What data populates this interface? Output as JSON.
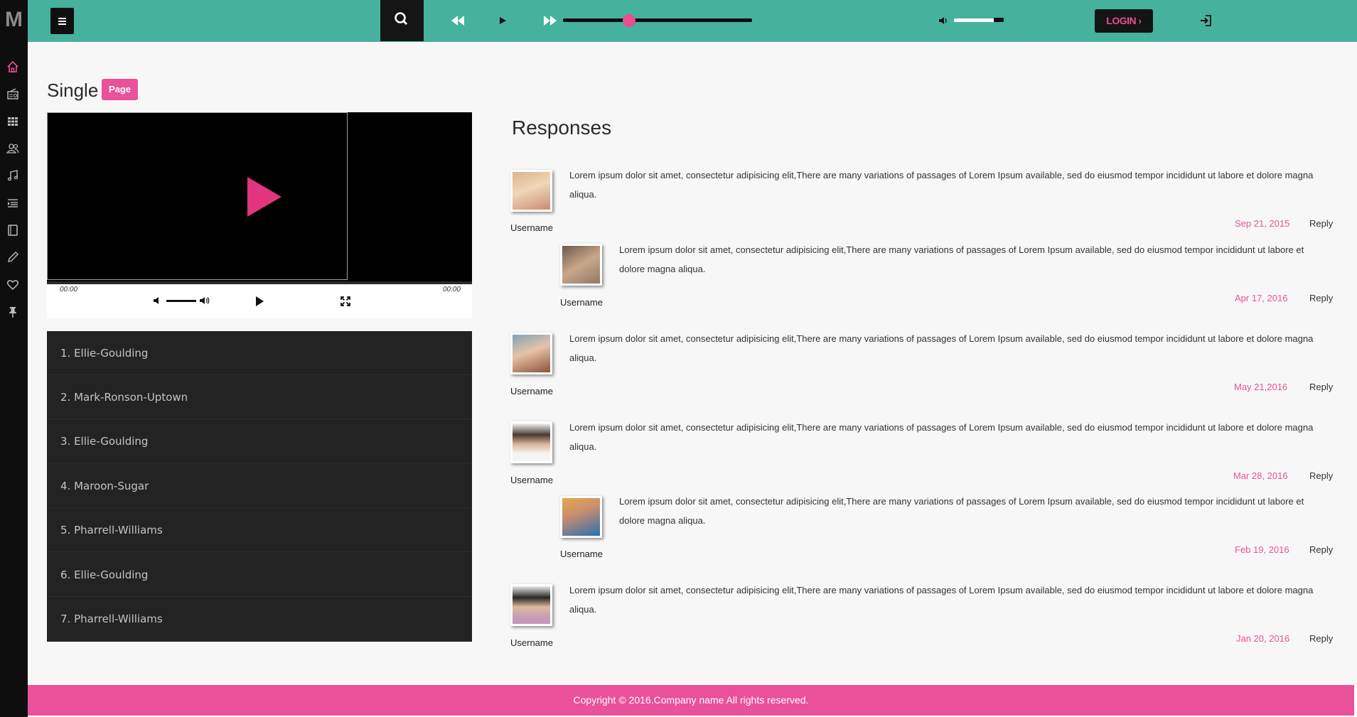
{
  "brand": {
    "logo": "M"
  },
  "sidebar": {
    "icons": [
      "home-icon",
      "radio-icon",
      "grid-icon",
      "users-icon",
      "music-icon",
      "playlist-icon",
      "book-icon",
      "pencil-icon",
      "heart-icon",
      "pin-icon"
    ],
    "active_color": "#e9519a"
  },
  "topbar": {
    "login_label": "LOGIN",
    "color": "#46b29d"
  },
  "player": {
    "seek_fraction": 0.35,
    "volume_fraction": 0.7
  },
  "page": {
    "title": "Single",
    "badge": "Page"
  },
  "video": {
    "time_start": "00:00",
    "time_end": "00:00"
  },
  "playlist": {
    "items": [
      "1. Ellie-Goulding",
      "2. Mark-Ronson-Uptown",
      "3. Ellie-Goulding",
      "4. Maroon-Sugar",
      "5. Pharrell-Williams",
      "6. Ellie-Goulding",
      "7. Pharrell-Williams"
    ]
  },
  "responses": {
    "title": "Responses",
    "reply_label": "Reply",
    "comments": [
      {
        "username": "Username",
        "date": "Sep 21, 2015",
        "line1": "Lorem ipsum dolor sit amet, consectetur adipisicing elit,There are many variations of passages of Lorem Ipsum available, sed do eiusmod tempor incididunt ut labore et dolore magna",
        "line2": "aliqua."
      },
      {
        "username": "Username",
        "date": "Apr 17, 2016",
        "line1": "Lorem ipsum dolor sit amet, consectetur adipisicing elit,There are many variations of passages of Lorem Ipsum available, sed do eiusmod tempor incididunt ut labore et",
        "line2": "dolore magna aliqua."
      },
      {
        "username": "Username",
        "date": "May 21,2016",
        "line1": "Lorem ipsum dolor sit amet, consectetur adipisicing elit,There are many variations of passages of Lorem Ipsum available, sed do eiusmod tempor incididunt ut labore et dolore magna",
        "line2": "aliqua."
      },
      {
        "username": "Username",
        "date": "Mar 28, 2016",
        "line1": "Lorem ipsum dolor sit amet, consectetur adipisicing elit,There are many variations of passages of Lorem Ipsum available, sed do eiusmod tempor incididunt ut labore et dolore magna",
        "line2": "aliqua."
      },
      {
        "username": "Username",
        "date": "Feb 19, 2016",
        "line1": "Lorem ipsum dolor sit amet, consectetur adipisicing elit,There are many variations of passages of Lorem Ipsum available, sed do eiusmod tempor incididunt ut labore et",
        "line2": "dolore magna aliqua."
      },
      {
        "username": "Username",
        "date": "Jan 20, 2016",
        "line1": "Lorem ipsum dolor sit amet, consectetur adipisicing elit,There are many variations of passages of Lorem Ipsum available, sed do eiusmod tempor incididunt ut labore et dolore magna",
        "line2": "aliqua."
      }
    ]
  },
  "footer": {
    "copyright": "Copyright © 2016.Company name All rights reserved."
  }
}
